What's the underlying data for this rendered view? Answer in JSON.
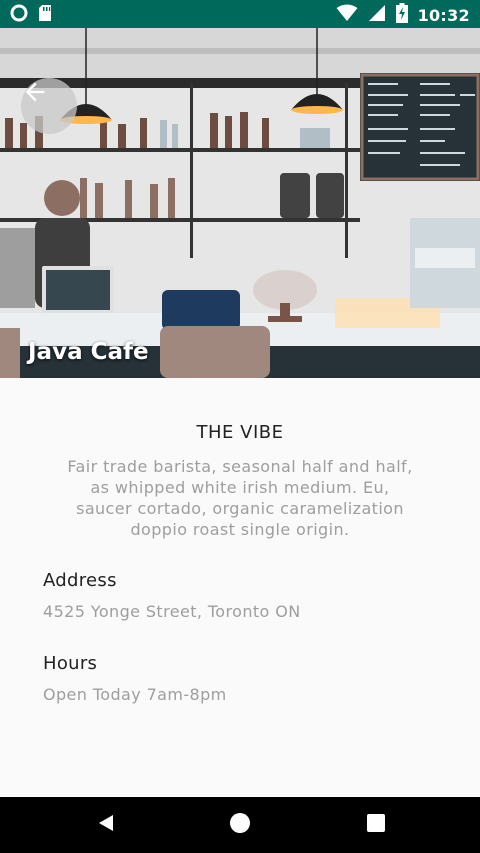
{
  "status_bar": {
    "time": "10:32",
    "icons": [
      "circle-notification-icon",
      "sd-card-icon",
      "wifi-icon",
      "signal-icon",
      "battery-charging-icon"
    ],
    "color": "#00695c"
  },
  "hero": {
    "title": "Java Cafe",
    "back_icon": "arrow-back-icon"
  },
  "vibe": {
    "heading": "THE VIBE",
    "text": "Fair trade barista, seasonal half and half, as whipped white irish medium. Eu, saucer cortado, organic caramelization doppio roast single origin."
  },
  "address": {
    "title": "Address",
    "value": "4525 Yonge Street, Toronto ON"
  },
  "hours": {
    "title": "Hours",
    "value": "Open Today 7am-8pm"
  },
  "nav_bar": {
    "icons": [
      "back-triangle-icon",
      "home-circle-icon",
      "recents-square-icon"
    ]
  },
  "colors": {
    "text_primary": "#222222",
    "text_secondary": "#9e9e9e",
    "background": "#fafafa"
  }
}
